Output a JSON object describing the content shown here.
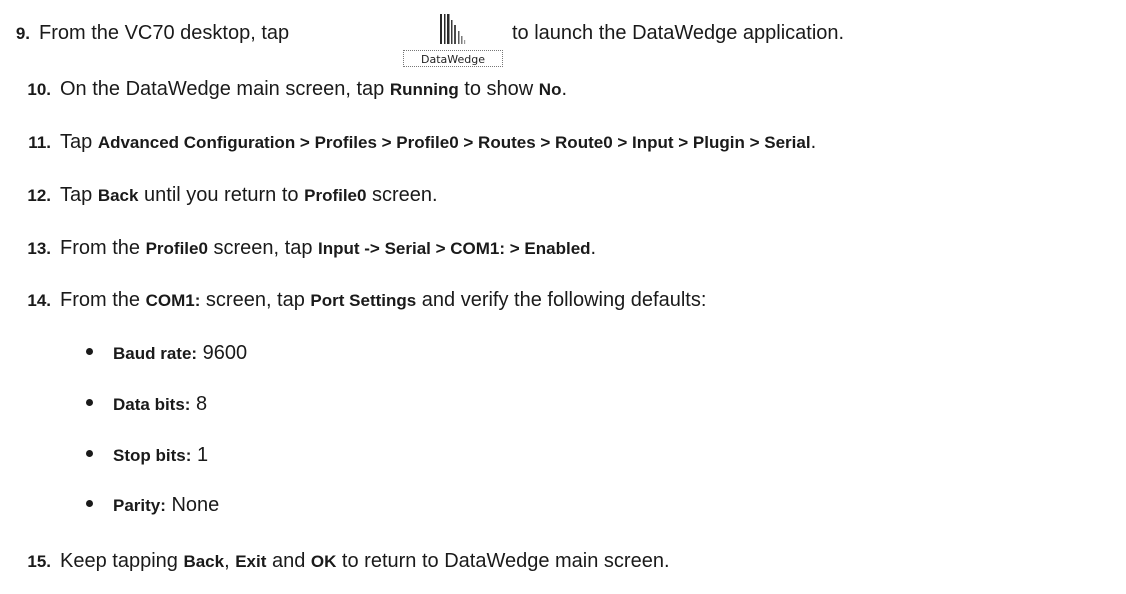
{
  "steps": {
    "s9": {
      "num": "9.",
      "pre": "From the VC70 desktop, tap",
      "post": "to launch the DataWedge application.",
      "icon": "datawedge-app-icon",
      "icon_label": "DataWedge"
    },
    "s10": {
      "num": "10.",
      "a": "On the DataWedge main screen, tap ",
      "b1": "Running",
      "c": " to show ",
      "b2": "No",
      "d": "."
    },
    "s11": {
      "num": "11.",
      "a": "Tap ",
      "b1": "Advanced Configuration > Profiles > Profile0 > Routes > Route0 > Input > Plugin > Serial",
      "d": "."
    },
    "s12": {
      "num": "12.",
      "a": "Tap ",
      "b1": "Back",
      "c": " until you return to ",
      "b2": "Profile0",
      "d": " screen."
    },
    "s13": {
      "num": "13.",
      "a": "From the ",
      "b1": "Profile0",
      "c": " screen, tap ",
      "b2": "Input -> Serial > COM1: > Enabled",
      "d": "."
    },
    "s14": {
      "num": "14.",
      "a": "From the ",
      "b1": "COM1:",
      "c": " screen, tap ",
      "b2": "Port Settings",
      "d": " and verify the following defaults:"
    },
    "s15": {
      "num": "15.",
      "a": "Keep tapping ",
      "b1": "Back",
      "c": ", ",
      "b2": "Exit",
      "e": " and ",
      "b3": "OK",
      "d": " to return to DataWedge main screen."
    }
  },
  "defaults": [
    {
      "label": "Baud rate:",
      "value": " 9600"
    },
    {
      "label": "Data bits:",
      "value": " 8"
    },
    {
      "label": "Stop bits:",
      "value": " 1"
    },
    {
      "label": "Parity:",
      "value": " None"
    }
  ]
}
